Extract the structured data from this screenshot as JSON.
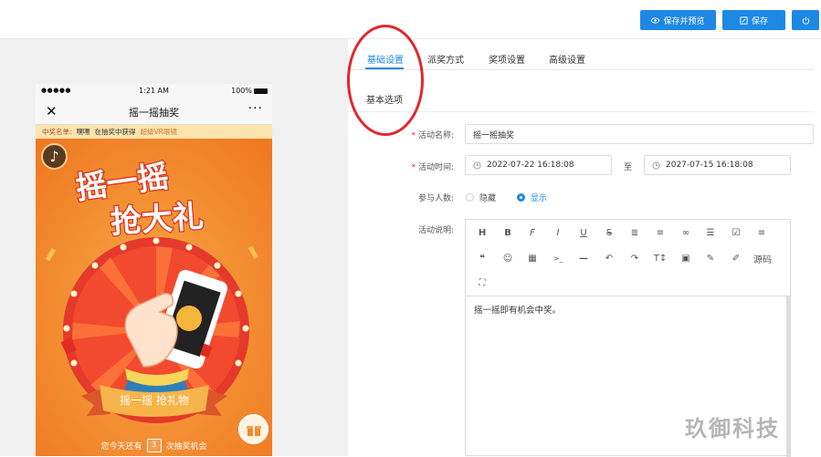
{
  "toolbar": {
    "preview_label": "保存并预览",
    "save_label": "保存"
  },
  "phone": {
    "status": {
      "signal": "●●●●●",
      "time": "1:21 AM",
      "battery": "100%"
    },
    "nav": {
      "close": "✕",
      "title": "摇一摇抽奖",
      "more": "···"
    },
    "ticker": {
      "prefix": "中奖名单:",
      "name": "嘿嘿",
      "action": "在抽奖中获得",
      "prize": "超级VR眼镜"
    },
    "poster": {
      "headline_1": "摇一摇",
      "headline_2": "抢大礼",
      "ribbon": "摇一摇 抢礼物"
    },
    "chances": {
      "before": "您今天还有",
      "count": "3",
      "after": "次抽奖机会"
    }
  },
  "tabs": [
    {
      "label": "基础设置",
      "active": true
    },
    {
      "label": "派奖方式",
      "active": false
    },
    {
      "label": "奖项设置",
      "active": false
    },
    {
      "label": "高级设置",
      "active": false
    }
  ],
  "section_title": "基本选项",
  "form": {
    "name": {
      "label": "活动名称:",
      "required": "*",
      "value": "摇一摇抽奖"
    },
    "time": {
      "label": "活动时间:",
      "required": "*",
      "start": "2022-07-22 16:18:08",
      "separator": "至",
      "end": "2027-07-15 16:18:08"
    },
    "participants": {
      "label": "参与人数:",
      "options": [
        "隐藏",
        "显示"
      ],
      "selected": "显示"
    },
    "description": {
      "label": "活动说明:",
      "source_label": "源码",
      "content": "摇一摇即有机会中奖。"
    }
  },
  "watermark": "玖御科技",
  "colors": {
    "primary": "#1e88e5",
    "highlight_circle": "#e3262d",
    "poster_orange": "#f28a2e"
  }
}
